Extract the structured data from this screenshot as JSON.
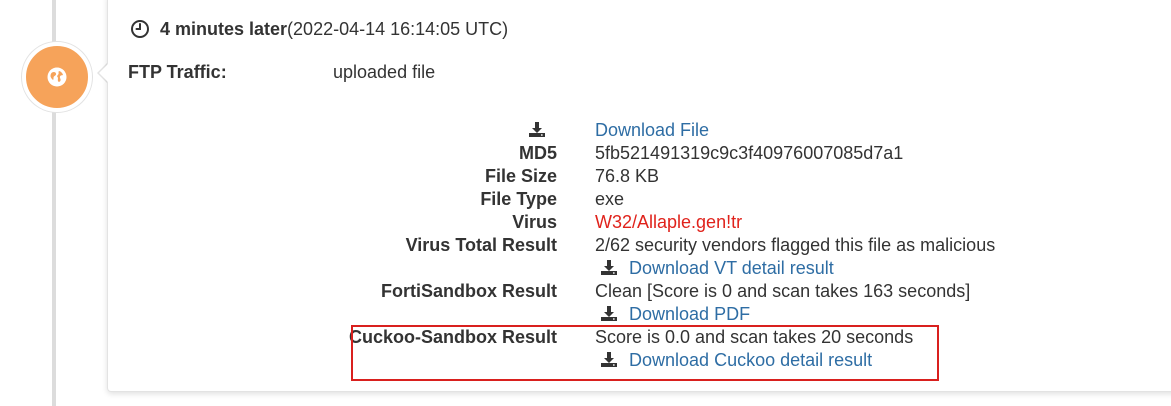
{
  "event": {
    "relative_time": "4 minutes later",
    "timestamp": "(2022-04-14 16:14:05 UTC)",
    "traffic_label": "FTP Traffic:",
    "traffic_value": "uploaded file"
  },
  "file": {
    "download_file_label": "Download File",
    "md5_label": "MD5",
    "md5_value": "5fb521491319c9c3f40976007085d7a1",
    "size_label": "File Size",
    "size_value": "76.8 KB",
    "type_label": "File Type",
    "type_value": "exe",
    "virus_label": "Virus",
    "virus_value": "W32/Allaple.gen!tr",
    "vt_label": "Virus Total Result",
    "vt_value": "2/62 security vendors flagged this file as malicious",
    "vt_download_label": "Download VT detail result",
    "fsa_label": "FortiSandbox Result",
    "fsa_value": "Clean [Score is 0 and scan takes 163 seconds]",
    "fsa_download_label": "Download PDF",
    "cuckoo_label": "Cuckoo-Sandbox Result",
    "cuckoo_value": "Score is 0.0 and scan takes 20 seconds",
    "cuckoo_download_label": "Download Cuckoo detail result"
  },
  "icons": {
    "badge": "globe-icon",
    "header": "clock-icon",
    "download": "download-icon"
  },
  "colors": {
    "badge": "#f6a35a",
    "link": "#2e6da4",
    "virus": "#e0221b",
    "highlight": "#d9201e"
  }
}
